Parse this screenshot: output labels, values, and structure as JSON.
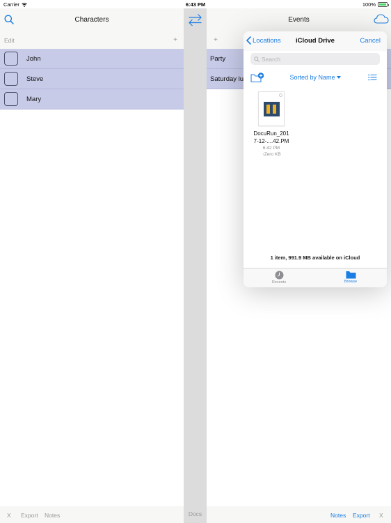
{
  "status_bar": {
    "carrier": "Carrier",
    "time": "6:43 PM",
    "battery": "100%",
    "icons": [
      "wifi-icon",
      "battery-icon"
    ]
  },
  "left_panel": {
    "title": "Characters",
    "search_icon": "search-icon",
    "edit_label": "Edit",
    "add_label": "+",
    "characters": [
      {
        "name": "John"
      },
      {
        "name": "Steve"
      },
      {
        "name": "Mary"
      }
    ],
    "footer": {
      "x_label": "X",
      "export_label": "Export",
      "notes_label": "Notes"
    }
  },
  "divider": {
    "swap_icon": "swap-arrows-icon",
    "docs_label": "Docs"
  },
  "right_panel": {
    "title": "Events",
    "cloud_icon": "cloud-icon",
    "add_label": "+",
    "events": [
      {
        "name": "Party"
      },
      {
        "name": "Saturday lu"
      }
    ],
    "footer": {
      "notes_label": "Notes",
      "export_label": "Export",
      "x_label": "X"
    }
  },
  "picker": {
    "back_label": "Locations",
    "title": "iCloud Drive",
    "cancel_label": "Cancel",
    "search_placeholder": "Search",
    "sort_label": "Sorted by Name",
    "file": {
      "name_line1": "DocuRun_201",
      "name_line2": "7-12-....42.PM",
      "time": "6:42 PM",
      "size": "↑Zero KB"
    },
    "storage_text": "1 item, 991.9 MB available on iCloud",
    "tabs": [
      {
        "label": "Recents",
        "icon": "clock-icon",
        "selected": false
      },
      {
        "label": "Browse",
        "icon": "folder-icon",
        "selected": true
      }
    ]
  },
  "colors": {
    "accent": "#1c7ee3",
    "row_highlight": "#c7cbe8",
    "bar_background": "#f7f7f5",
    "muted_text": "#9a9a9a"
  }
}
